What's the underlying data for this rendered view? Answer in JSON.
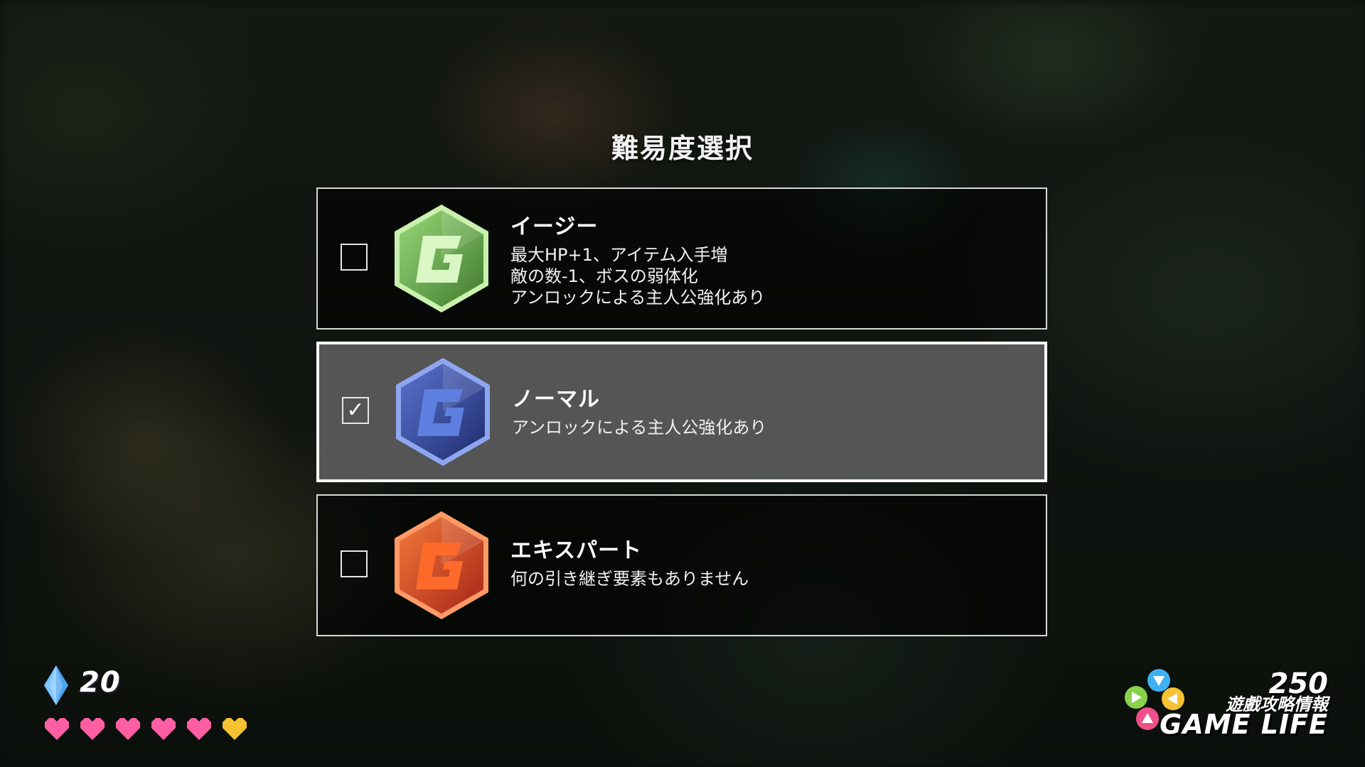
{
  "screen": {
    "title": "難易度選択"
  },
  "options": [
    {
      "name": "イージー",
      "selected": false,
      "badge_color": "#7cc05a",
      "description": [
        "最大HP+1、アイテム入手増",
        "敵の数-1、ボスの弱体化",
        "アンロックによる主人公強化あり"
      ]
    },
    {
      "name": "ノーマル",
      "selected": true,
      "badge_color": "#3c50a8",
      "description": [
        "アンロックによる主人公強化あり"
      ]
    },
    {
      "name": "エキスパート",
      "selected": false,
      "badge_color": "#e0562a",
      "description": [
        "何の引き継ぎ要素もありません"
      ]
    }
  ],
  "hud": {
    "gem_count": "20",
    "hearts": [
      {
        "color": "#ff5fa2"
      },
      {
        "color": "#ff5fa2"
      },
      {
        "color": "#ff5fa2"
      },
      {
        "color": "#ff5fa2"
      },
      {
        "color": "#ff5fa2"
      },
      {
        "color": "#f5c232"
      }
    ]
  },
  "watermark": {
    "number": "250",
    "chinese": "遊戲攻略情報",
    "english": "GAME LIFE"
  }
}
